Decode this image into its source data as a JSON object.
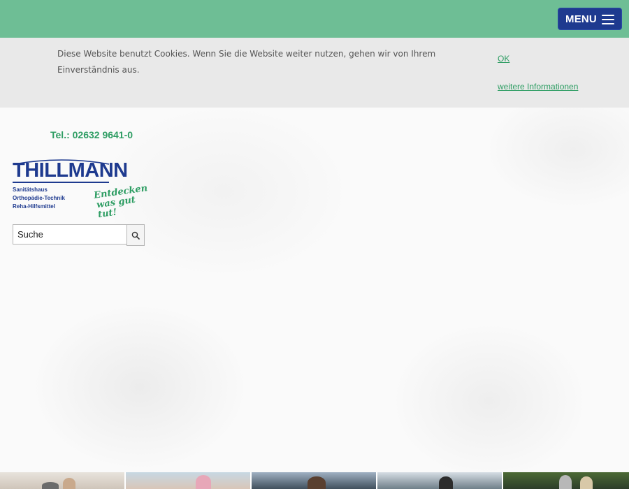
{
  "header": {
    "menu_label": "MENU"
  },
  "cookie_notice": {
    "text": "Diese Website benutzt Cookies. Wenn Sie die Website weiter nutzen, gehen wir von Ihrem Einverständnis aus.",
    "ok_label": "OK",
    "more_label": "weitere Informationen"
  },
  "contact": {
    "phone": "Tel.: 02632 9641-0"
  },
  "logo": {
    "name": "THILLMANN",
    "line1": "Sanitätshaus",
    "line2": "Orthopädie-Technik",
    "line3": "Reha-Hilfsmittel",
    "slogan1": "Entdecken",
    "slogan2": "was gut tut!"
  },
  "search": {
    "value": "Suche",
    "icon": "search-icon"
  },
  "colors": {
    "header_green": "#6ebe95",
    "menu_blue": "#1e3a8f",
    "link_green": "#2e9d63",
    "cookie_bg": "#e9e9e9"
  },
  "image_strip": {
    "count": 5
  }
}
